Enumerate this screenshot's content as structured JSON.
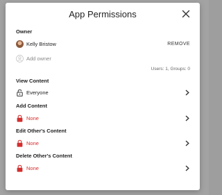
{
  "dialog": {
    "title": "App Permissions",
    "owner": {
      "label": "Owner",
      "name": "Kelly Bristow",
      "remove_label": "REMOVE",
      "add_owner_label": "Add owner",
      "counts": "Users: 1, Groups: 0"
    },
    "sections": [
      {
        "label": "View Content",
        "value": "Everyone",
        "restricted": false
      },
      {
        "label": "Add Content",
        "value": "None",
        "restricted": true
      },
      {
        "label": "Edit Other's Content",
        "value": "None",
        "restricted": true
      },
      {
        "label": "Delete Other's Content",
        "value": "None",
        "restricted": true
      }
    ]
  },
  "colors": {
    "restricted": "#d32f2f",
    "text": "#222222",
    "muted": "#888888"
  },
  "icons": {
    "close": "close-icon",
    "lock_open": "lock-open-icon",
    "lock_closed": "lock-icon",
    "chevron": "chevron-right-icon",
    "add_person": "person-add-icon"
  }
}
